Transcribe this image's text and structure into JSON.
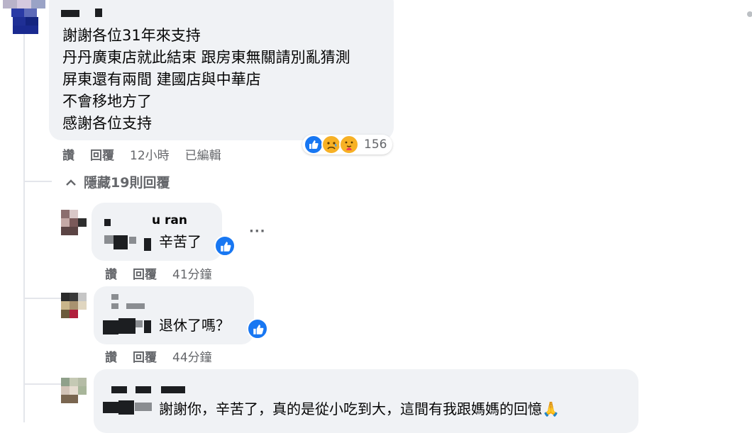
{
  "main_comment": {
    "lines": [
      "謝謝各位31年來支持",
      "丹丹廣東店就此結束 跟房東無關請別亂猜測",
      "屏東還有兩間 建國店與中華店",
      "不會移地方了",
      "感謝各位支持"
    ],
    "reaction_count": "156",
    "reactions": [
      "like-icon",
      "sad-icon",
      "care-icon"
    ],
    "actions": {
      "like": "讚",
      "reply": "回覆",
      "time": "12小時",
      "edited": "已編輯"
    }
  },
  "hide_replies_label": "隱藏19則回覆",
  "replies": [
    {
      "name_partial": "u ran",
      "text": "辛苦了",
      "like": "讚",
      "reply": "回覆",
      "time": "41分鐘"
    },
    {
      "text": "退休了嗎？",
      "like": "讚",
      "reply": "回覆",
      "time": "44分鐘"
    },
    {
      "text": "謝謝你，辛苦了，真的是從小吃到大，這間有我跟媽媽的回憶🙏"
    }
  ],
  "more_options": "···",
  "colors": {
    "bubble": "#f0f2f5",
    "meta": "#65676b",
    "like_blue": "#1877f2"
  }
}
